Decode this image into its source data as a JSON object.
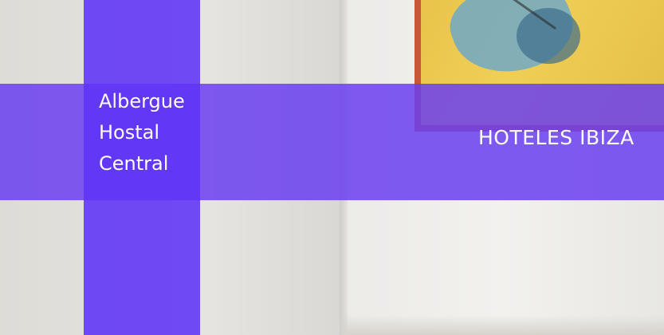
{
  "title_lines": [
    "Albergue",
    "Hostal",
    "Central"
  ],
  "category_link": "HOTELES IBIZA",
  "colors": {
    "overlay": "#6a3ef0",
    "text": "#ffffff"
  }
}
